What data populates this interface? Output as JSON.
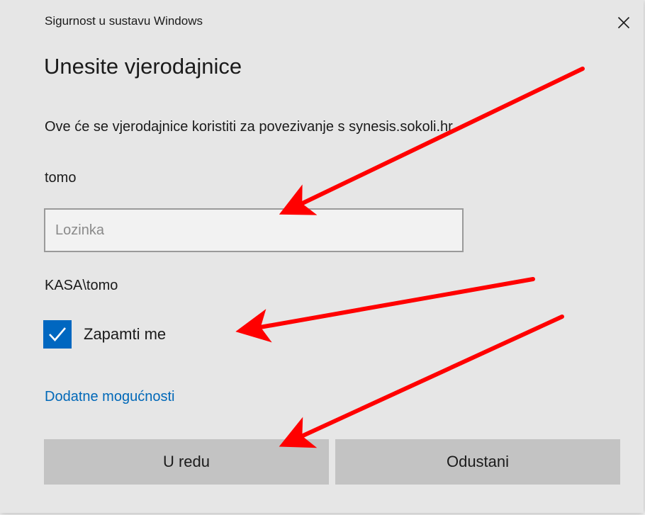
{
  "window": {
    "title": "Sigurnost u sustavu Windows",
    "close_icon": "close-icon"
  },
  "heading": "Unesite vjerodajnice",
  "description": "Ove će se vjerodajnice koristiti za povezivanje s synesis.sokoli.hr.",
  "username": "tomo",
  "password": {
    "value": "",
    "placeholder": "Lozinka"
  },
  "domain_user": "KASA\\tomo",
  "remember": {
    "label": "Zapamti me",
    "checked": true,
    "icon": "checkmark-icon"
  },
  "more_options_link": "Dodatne mogućnosti",
  "buttons": {
    "ok": "U redu",
    "cancel": "Odustani"
  },
  "colors": {
    "accent": "#0067c0",
    "link": "#0068b8",
    "annotation_arrow": "#ff0000",
    "button_bg": "#c3c3c3",
    "dialog_bg": "#e6e6e6"
  },
  "annotations": [
    {
      "name": "arrow-to-password",
      "points_to": "password-input"
    },
    {
      "name": "arrow-to-remember",
      "points_to": "remember-checkbox"
    },
    {
      "name": "arrow-to-ok",
      "points_to": "ok-button"
    }
  ]
}
